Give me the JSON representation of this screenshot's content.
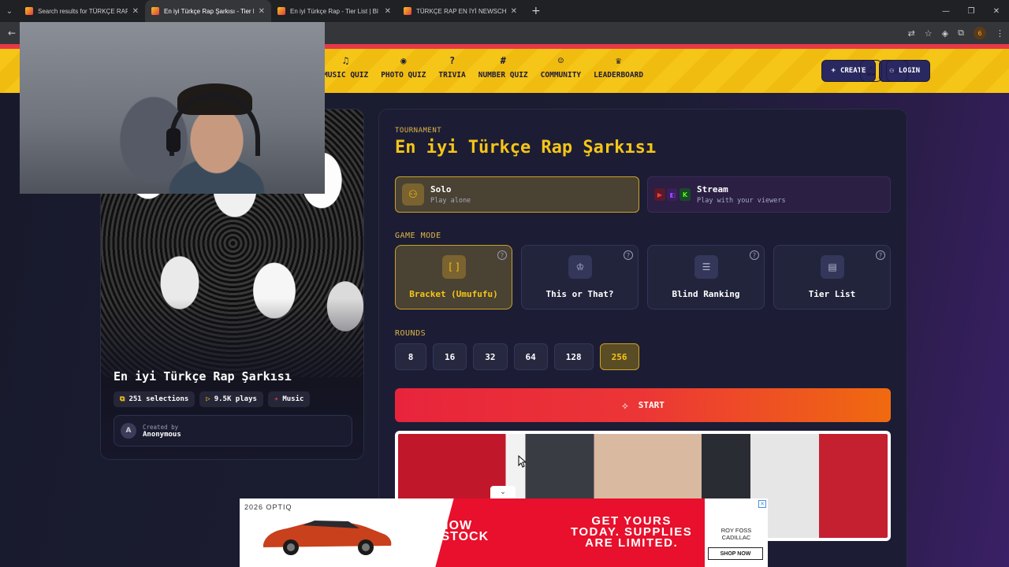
{
  "browser": {
    "tabs": [
      {
        "title": "Search results for TÜRKÇE RAP",
        "active": false
      },
      {
        "title": "En iyi Türkçe Rap Şarkısı - Tier L",
        "active": true
      },
      {
        "title": "En iyi Türkçe Rap - Tier List | Bl",
        "active": false
      },
      {
        "title": "TÜRKÇE RAP EN İYİ NEWSCHO",
        "active": false
      }
    ],
    "new_tab": "+",
    "profile_initial": "6"
  },
  "header": {
    "nav": [
      {
        "label": "MUSIC QUIZ",
        "icon": "music-note-icon"
      },
      {
        "label": "PHOTO QUIZ",
        "icon": "camera-icon"
      },
      {
        "label": "TRIVIA",
        "icon": "question-icon"
      },
      {
        "label": "NUMBER QUIZ",
        "icon": "hash-icon"
      },
      {
        "label": "COMMUNITY",
        "icon": "users-icon"
      },
      {
        "label": "LEADERBOARD",
        "icon": "trophy-icon"
      }
    ],
    "create_label": "CREATE",
    "login_label": "LOGIN"
  },
  "card": {
    "title": "En iyi Türkçe Rap Şarkısı",
    "selections": "251 selections",
    "plays": "9.5K plays",
    "category": "Music",
    "created_by_label": "Created by",
    "creator": "Anonymous",
    "creator_initial": "A"
  },
  "panel": {
    "kicker": "TOURNAMENT",
    "title": "En iyi Türkçe Rap Şarkısı",
    "solo": {
      "title": "Solo",
      "subtitle": "Play alone"
    },
    "stream": {
      "title": "Stream",
      "subtitle": "Play with your viewers"
    },
    "game_mode_label": "GAME MODE",
    "modes": [
      {
        "label": "Bracket (Umufufu)",
        "icon": "bracket-icon",
        "active": true
      },
      {
        "label": "This or That?",
        "icon": "crown-icon",
        "active": false
      },
      {
        "label": "Blind Ranking",
        "icon": "list-icon",
        "active": false
      },
      {
        "label": "Tier List",
        "icon": "rows-icon",
        "active": false
      }
    ],
    "rounds_label": "ROUNDS",
    "rounds": [
      "8",
      "16",
      "32",
      "64",
      "128",
      "256"
    ],
    "selected_round": "256",
    "start_label": "START"
  },
  "ad": {
    "brand": "2026 OPTIQ",
    "headline1": "NOW\nIN STOCK",
    "headline2": "GET YOURS\nTODAY. SUPPLIES\nARE LIMITED.",
    "dealer": "ROY FOSS\nCADILLAC",
    "cta": "SHOP NOW"
  }
}
